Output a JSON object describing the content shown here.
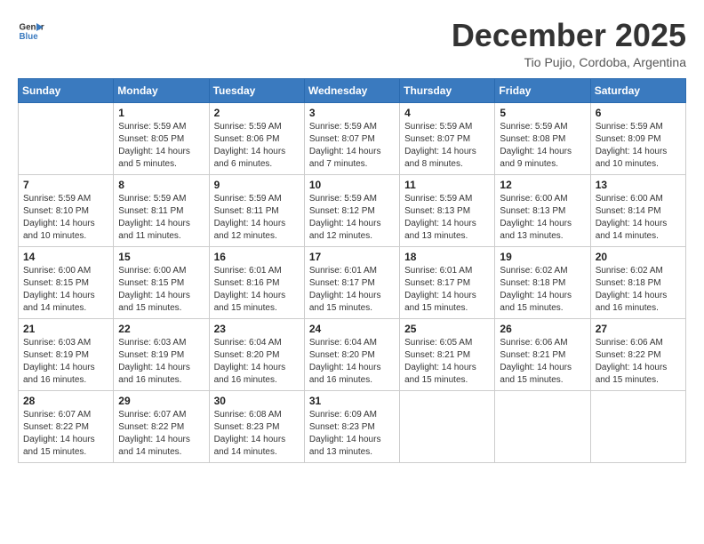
{
  "header": {
    "logo_line1": "General",
    "logo_line2": "Blue",
    "title": "December 2025",
    "subtitle": "Tio Pujio, Cordoba, Argentina"
  },
  "calendar": {
    "days_of_week": [
      "Sunday",
      "Monday",
      "Tuesday",
      "Wednesday",
      "Thursday",
      "Friday",
      "Saturday"
    ],
    "weeks": [
      [
        {
          "day": "",
          "info": ""
        },
        {
          "day": "1",
          "info": "Sunrise: 5:59 AM\nSunset: 8:05 PM\nDaylight: 14 hours\nand 5 minutes."
        },
        {
          "day": "2",
          "info": "Sunrise: 5:59 AM\nSunset: 8:06 PM\nDaylight: 14 hours\nand 6 minutes."
        },
        {
          "day": "3",
          "info": "Sunrise: 5:59 AM\nSunset: 8:07 PM\nDaylight: 14 hours\nand 7 minutes."
        },
        {
          "day": "4",
          "info": "Sunrise: 5:59 AM\nSunset: 8:07 PM\nDaylight: 14 hours\nand 8 minutes."
        },
        {
          "day": "5",
          "info": "Sunrise: 5:59 AM\nSunset: 8:08 PM\nDaylight: 14 hours\nand 9 minutes."
        },
        {
          "day": "6",
          "info": "Sunrise: 5:59 AM\nSunset: 8:09 PM\nDaylight: 14 hours\nand 10 minutes."
        }
      ],
      [
        {
          "day": "7",
          "info": "Sunrise: 5:59 AM\nSunset: 8:10 PM\nDaylight: 14 hours\nand 10 minutes."
        },
        {
          "day": "8",
          "info": "Sunrise: 5:59 AM\nSunset: 8:11 PM\nDaylight: 14 hours\nand 11 minutes."
        },
        {
          "day": "9",
          "info": "Sunrise: 5:59 AM\nSunset: 8:11 PM\nDaylight: 14 hours\nand 12 minutes."
        },
        {
          "day": "10",
          "info": "Sunrise: 5:59 AM\nSunset: 8:12 PM\nDaylight: 14 hours\nand 12 minutes."
        },
        {
          "day": "11",
          "info": "Sunrise: 5:59 AM\nSunset: 8:13 PM\nDaylight: 14 hours\nand 13 minutes."
        },
        {
          "day": "12",
          "info": "Sunrise: 6:00 AM\nSunset: 8:13 PM\nDaylight: 14 hours\nand 13 minutes."
        },
        {
          "day": "13",
          "info": "Sunrise: 6:00 AM\nSunset: 8:14 PM\nDaylight: 14 hours\nand 14 minutes."
        }
      ],
      [
        {
          "day": "14",
          "info": "Sunrise: 6:00 AM\nSunset: 8:15 PM\nDaylight: 14 hours\nand 14 minutes."
        },
        {
          "day": "15",
          "info": "Sunrise: 6:00 AM\nSunset: 8:15 PM\nDaylight: 14 hours\nand 15 minutes."
        },
        {
          "day": "16",
          "info": "Sunrise: 6:01 AM\nSunset: 8:16 PM\nDaylight: 14 hours\nand 15 minutes."
        },
        {
          "day": "17",
          "info": "Sunrise: 6:01 AM\nSunset: 8:17 PM\nDaylight: 14 hours\nand 15 minutes."
        },
        {
          "day": "18",
          "info": "Sunrise: 6:01 AM\nSunset: 8:17 PM\nDaylight: 14 hours\nand 15 minutes."
        },
        {
          "day": "19",
          "info": "Sunrise: 6:02 AM\nSunset: 8:18 PM\nDaylight: 14 hours\nand 15 minutes."
        },
        {
          "day": "20",
          "info": "Sunrise: 6:02 AM\nSunset: 8:18 PM\nDaylight: 14 hours\nand 16 minutes."
        }
      ],
      [
        {
          "day": "21",
          "info": "Sunrise: 6:03 AM\nSunset: 8:19 PM\nDaylight: 14 hours\nand 16 minutes."
        },
        {
          "day": "22",
          "info": "Sunrise: 6:03 AM\nSunset: 8:19 PM\nDaylight: 14 hours\nand 16 minutes."
        },
        {
          "day": "23",
          "info": "Sunrise: 6:04 AM\nSunset: 8:20 PM\nDaylight: 14 hours\nand 16 minutes."
        },
        {
          "day": "24",
          "info": "Sunrise: 6:04 AM\nSunset: 8:20 PM\nDaylight: 14 hours\nand 16 minutes."
        },
        {
          "day": "25",
          "info": "Sunrise: 6:05 AM\nSunset: 8:21 PM\nDaylight: 14 hours\nand 15 minutes."
        },
        {
          "day": "26",
          "info": "Sunrise: 6:06 AM\nSunset: 8:21 PM\nDaylight: 14 hours\nand 15 minutes."
        },
        {
          "day": "27",
          "info": "Sunrise: 6:06 AM\nSunset: 8:22 PM\nDaylight: 14 hours\nand 15 minutes."
        }
      ],
      [
        {
          "day": "28",
          "info": "Sunrise: 6:07 AM\nSunset: 8:22 PM\nDaylight: 14 hours\nand 15 minutes."
        },
        {
          "day": "29",
          "info": "Sunrise: 6:07 AM\nSunset: 8:22 PM\nDaylight: 14 hours\nand 14 minutes."
        },
        {
          "day": "30",
          "info": "Sunrise: 6:08 AM\nSunset: 8:23 PM\nDaylight: 14 hours\nand 14 minutes."
        },
        {
          "day": "31",
          "info": "Sunrise: 6:09 AM\nSunset: 8:23 PM\nDaylight: 14 hours\nand 13 minutes."
        },
        {
          "day": "",
          "info": ""
        },
        {
          "day": "",
          "info": ""
        },
        {
          "day": "",
          "info": ""
        }
      ]
    ]
  }
}
